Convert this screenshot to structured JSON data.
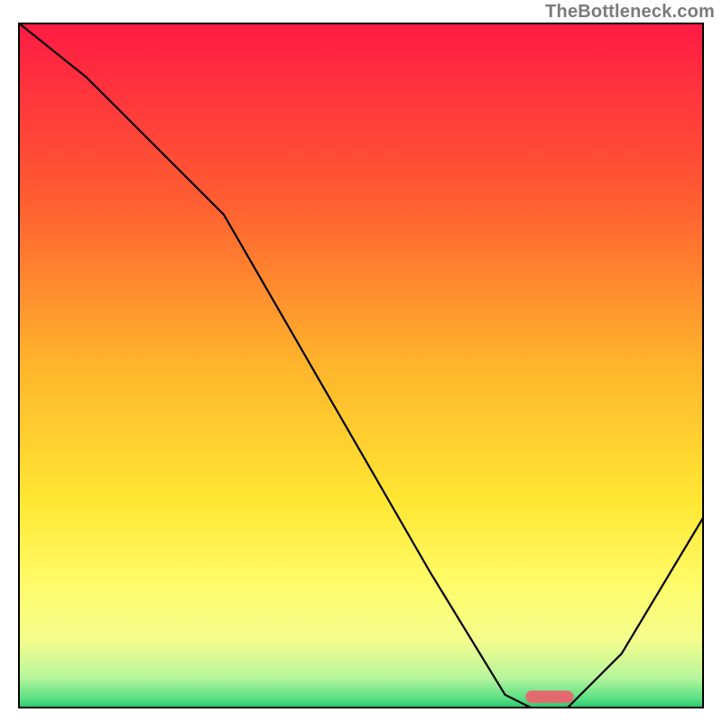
{
  "watermark": {
    "text": "TheBottleneck.com"
  },
  "chart_data": {
    "type": "line",
    "title": "",
    "xlabel": "",
    "ylabel": "",
    "xlim": [
      0,
      100
    ],
    "ylim": [
      0,
      100
    ],
    "grid": false,
    "legend": false,
    "background_gradient_colors": {
      "stops": [
        {
          "offset": 0.0,
          "color": "#ff1a44"
        },
        {
          "offset": 0.25,
          "color": "#ff5a32"
        },
        {
          "offset": 0.5,
          "color": "#ffb52b"
        },
        {
          "offset": 0.7,
          "color": "#ffe733"
        },
        {
          "offset": 0.82,
          "color": "#fffc6a"
        },
        {
          "offset": 0.9,
          "color": "#f4fd8d"
        },
        {
          "offset": 0.955,
          "color": "#b7f59c"
        },
        {
          "offset": 0.985,
          "color": "#5ce084"
        },
        {
          "offset": 1.0,
          "color": "#24c46a"
        }
      ]
    },
    "series": [
      {
        "name": "bottleneck-curve",
        "color": "#000000",
        "x": [
          0,
          10,
          22,
          30,
          45,
          60,
          71,
          75,
          80,
          88,
          100
        ],
        "y": [
          100,
          92,
          80,
          72,
          46,
          20,
          2,
          0,
          0,
          8,
          28
        ]
      }
    ],
    "marker": {
      "name": "optimal-range",
      "color": "#e46a6f",
      "x_start": 74,
      "x_end": 81,
      "y": 0.8,
      "height_pct": 1.8
    }
  }
}
